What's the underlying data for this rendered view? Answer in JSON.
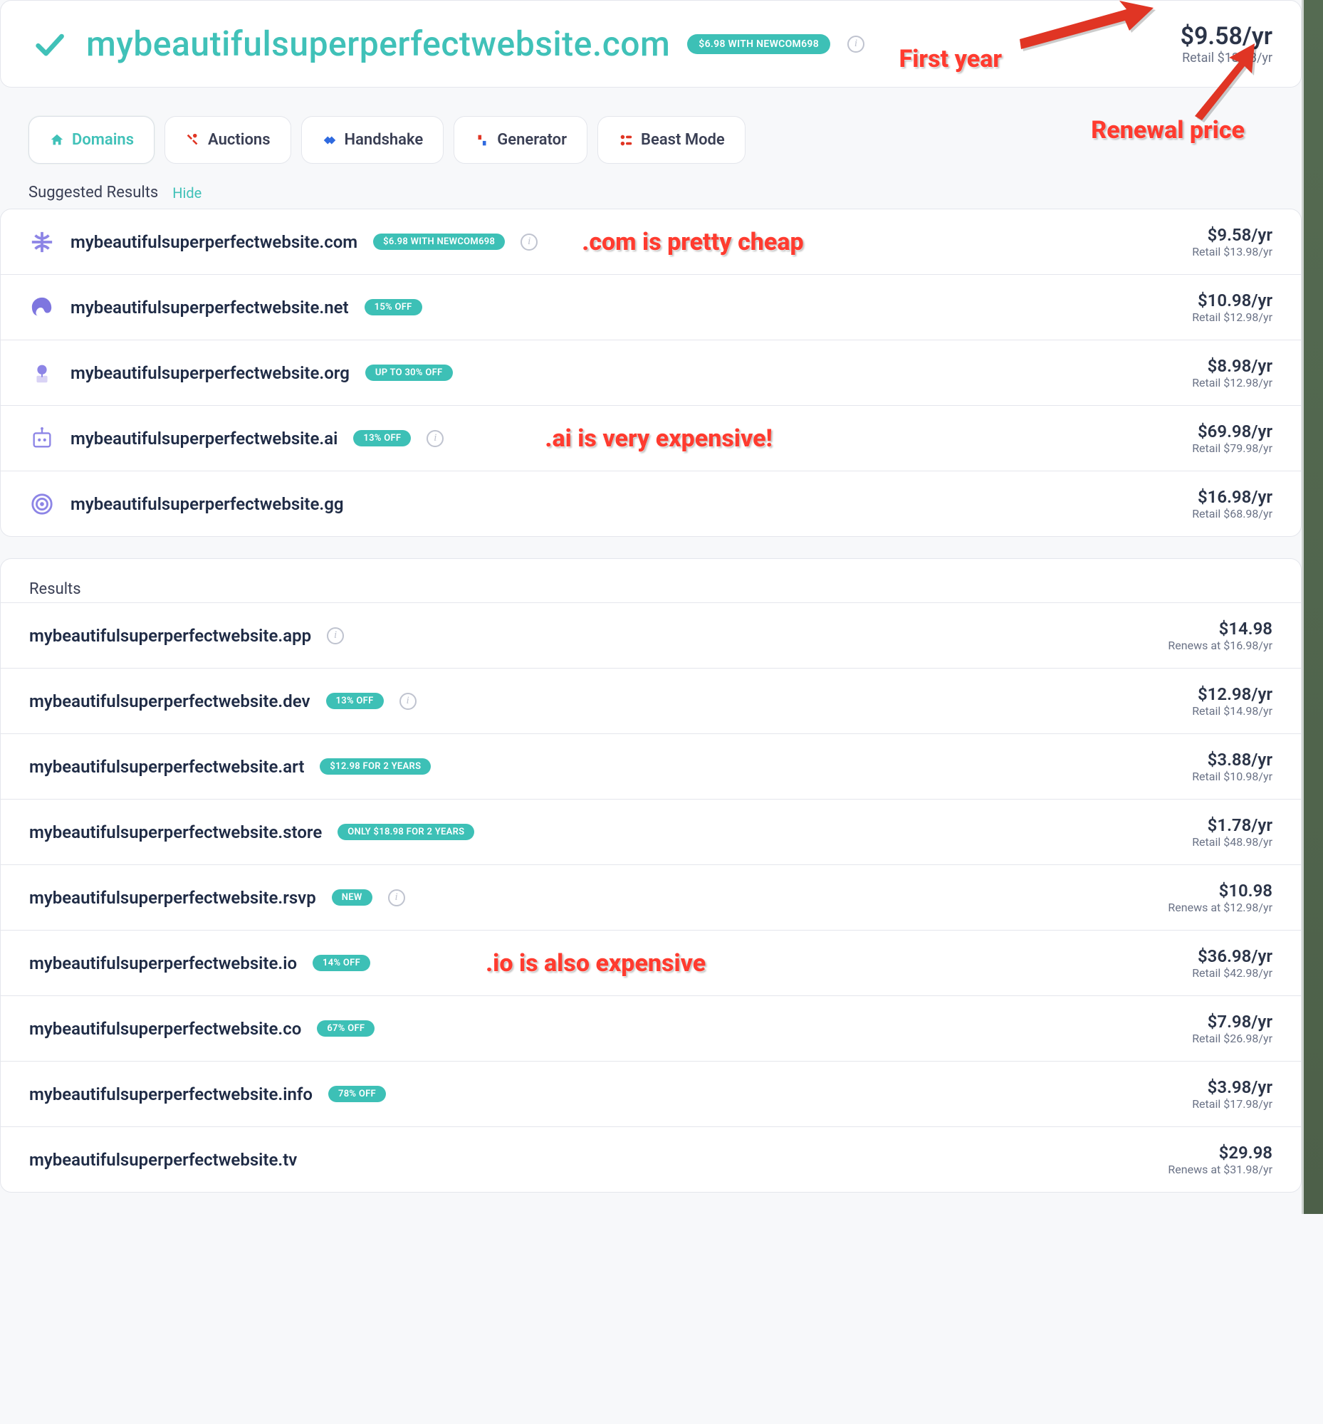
{
  "main": {
    "domain": "mybeautifulsuperperfectwebsite.com",
    "promo_badge": "$6.98 WITH NEWCOM698",
    "price": "$9.58/yr",
    "retail": "Retail $13.98/yr"
  },
  "tabs": [
    {
      "label": "Domains",
      "active": true
    },
    {
      "label": "Auctions",
      "active": false
    },
    {
      "label": "Handshake",
      "active": false
    },
    {
      "label": "Generator",
      "active": false
    },
    {
      "label": "Beast Mode",
      "active": false
    }
  ],
  "suggested_header": "Suggested Results",
  "hide_label": "Hide",
  "suggested": [
    {
      "domain": "mybeautifulsuperperfectwebsite.com",
      "badge": "$6.98 WITH NEWCOM698",
      "info": true,
      "price": "$9.58/yr",
      "retail": "Retail $13.98/yr",
      "icon": "globe"
    },
    {
      "domain": "mybeautifulsuperperfectwebsite.net",
      "badge": "15% OFF",
      "info": false,
      "price": "$10.98/yr",
      "retail": "Retail $12.98/yr",
      "icon": "swirl"
    },
    {
      "domain": "mybeautifulsuperperfectwebsite.org",
      "badge": "UP TO 30% OFF",
      "info": false,
      "price": "$8.98/yr",
      "retail": "Retail $12.98/yr",
      "icon": "plant"
    },
    {
      "domain": "mybeautifulsuperperfectwebsite.ai",
      "badge": "13% OFF",
      "info": true,
      "price": "$69.98/yr",
      "retail": "Retail $79.98/yr",
      "icon": "robot"
    },
    {
      "domain": "mybeautifulsuperperfectwebsite.gg",
      "badge": "",
      "info": false,
      "price": "$16.98/yr",
      "retail": "Retail $68.98/yr",
      "icon": "target"
    }
  ],
  "results_header": "Results",
  "results": [
    {
      "domain": "mybeautifulsuperperfectwebsite.app",
      "badge": "",
      "info": true,
      "price": "$14.98",
      "retail": "Renews at $16.98/yr"
    },
    {
      "domain": "mybeautifulsuperperfectwebsite.dev",
      "badge": "13% OFF",
      "info": true,
      "price": "$12.98/yr",
      "retail": "Retail $14.98/yr"
    },
    {
      "domain": "mybeautifulsuperperfectwebsite.art",
      "badge": "$12.98 FOR 2 YEARS",
      "info": false,
      "price": "$3.88/yr",
      "retail": "Retail $10.98/yr"
    },
    {
      "domain": "mybeautifulsuperperfectwebsite.store",
      "badge": "ONLY $18.98 FOR 2 YEARS",
      "info": false,
      "price": "$1.78/yr",
      "retail": "Retail $48.98/yr"
    },
    {
      "domain": "mybeautifulsuperperfectwebsite.rsvp",
      "badge": "NEW",
      "info": true,
      "price": "$10.98",
      "retail": "Renews at $12.98/yr"
    },
    {
      "domain": "mybeautifulsuperperfectwebsite.io",
      "badge": "14% OFF",
      "info": false,
      "price": "$36.98/yr",
      "retail": "Retail $42.98/yr"
    },
    {
      "domain": "mybeautifulsuperperfectwebsite.co",
      "badge": "67% OFF",
      "info": false,
      "price": "$7.98/yr",
      "retail": "Retail $26.98/yr"
    },
    {
      "domain": "mybeautifulsuperperfectwebsite.info",
      "badge": "78% OFF",
      "info": false,
      "price": "$3.98/yr",
      "retail": "Retail $17.98/yr"
    },
    {
      "domain": "mybeautifulsuperperfectwebsite.tv",
      "badge": "",
      "info": false,
      "price": "$29.98",
      "retail": "Renews at $31.98/yr"
    }
  ],
  "annotations": {
    "first_year": "First year",
    "renewal": "Renewal price",
    "com_cheap": ".com is pretty cheap",
    "ai_expensive": ".ai is very expensive!",
    "io_expensive": ".io is also expensive"
  }
}
